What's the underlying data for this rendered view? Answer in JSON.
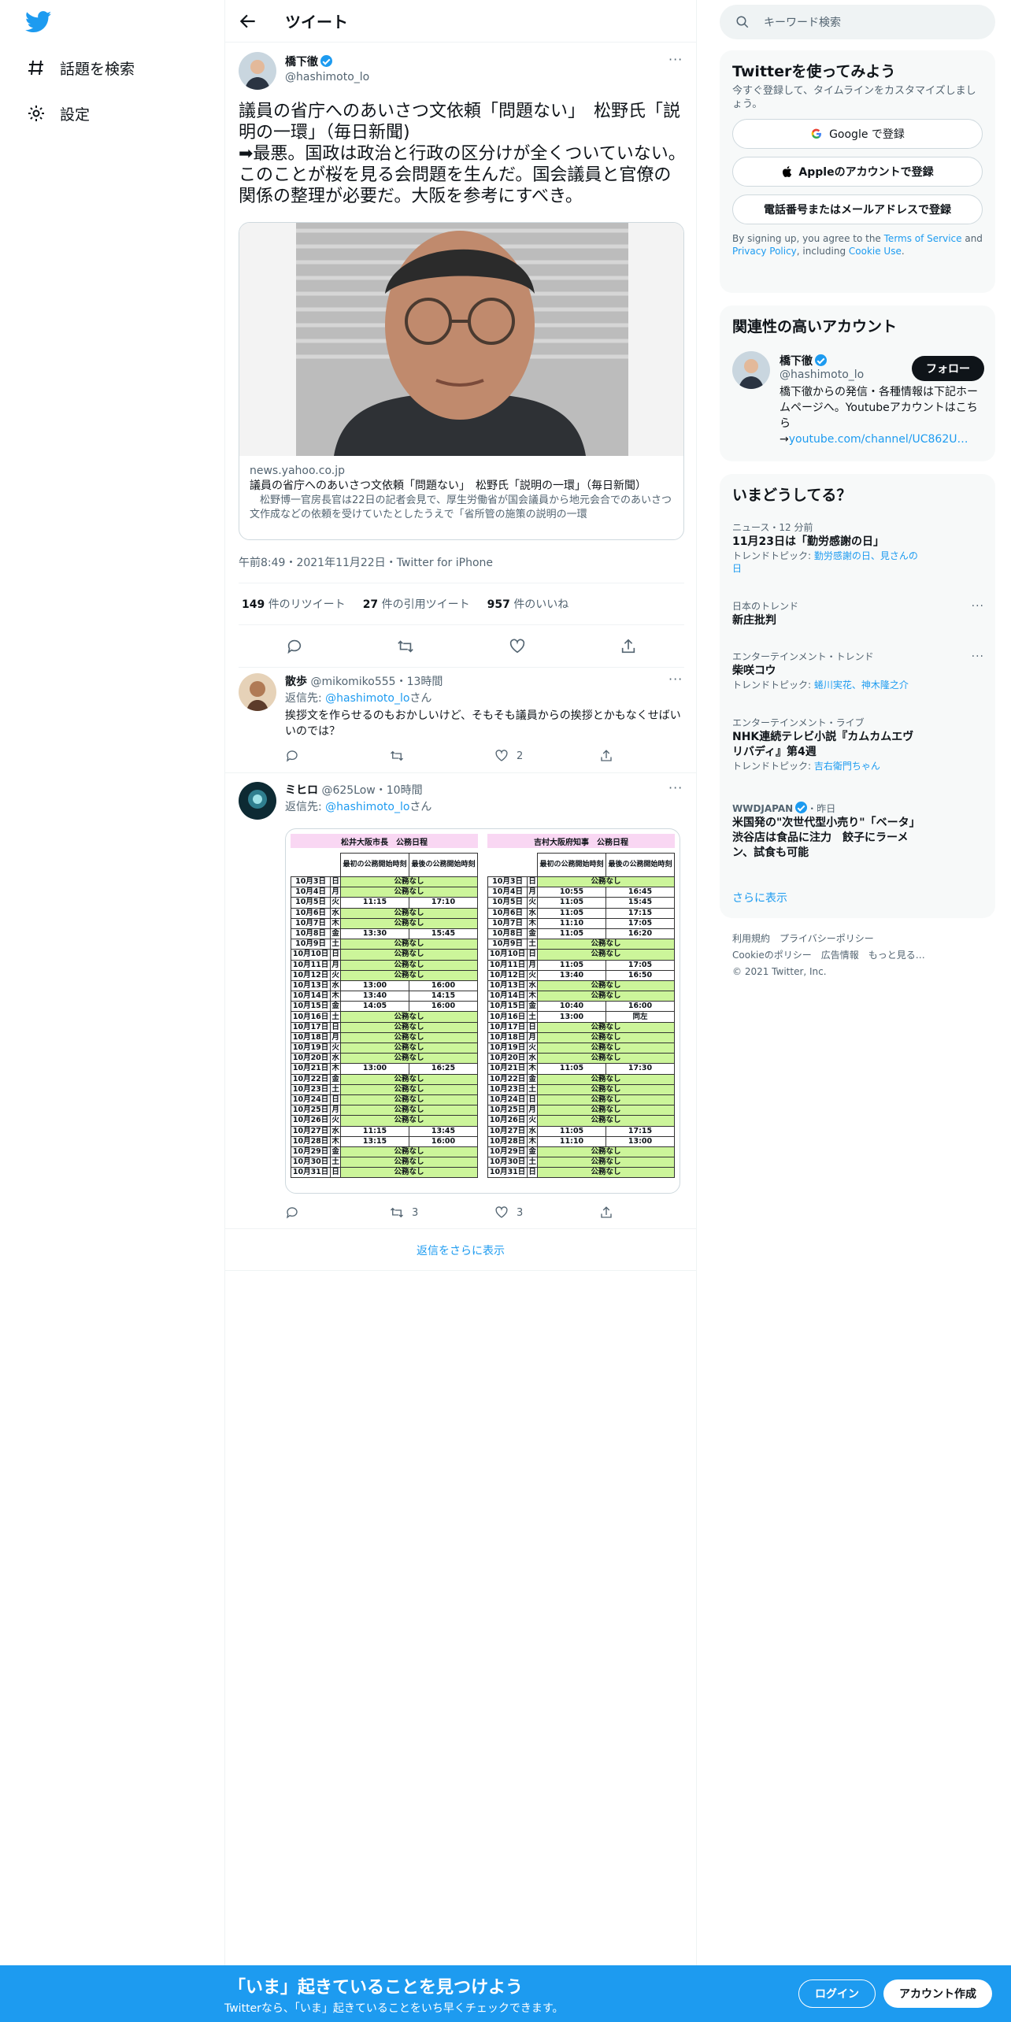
{
  "nav": {
    "explore": "話題を検索",
    "settings": "設定"
  },
  "header": {
    "title": "ツイート"
  },
  "tweet": {
    "author": "橋下徹",
    "handle": "@hashimoto_lo",
    "text": "議員の省庁へのあいさつ文依頼「問題ない」　松野氏「説明の一環」（毎日新聞)\n➡最悪。国政は政治と行政の区分けが全くついていない。このことが桜を見る会問題を生んだ。国会議員と官僚の関係の整理が必要だ。大阪を参考にすべき。",
    "card": {
      "domain": "news.yahoo.co.jp",
      "title": "議員の省庁へのあいさつ文依頼「問題ない」　松野氏「説明の一環」（毎日新聞）",
      "desc": "　松野博一官房長官は22日の記者会見で、厚生労働省が国会議員から地元会合でのあいさつ文作成などの依頼を受けていたとしたうえで「省所管の施策の説明の一環"
    },
    "time": "午前8:49・2021年11月22日・Twitter for iPhone",
    "retweets": "149",
    "retweets_label": "件のリツイート",
    "quotes": "27",
    "quotes_label": "件の引用ツイート",
    "likes": "957",
    "likes_label": "件のいいね"
  },
  "replies": [
    {
      "name": "散歩",
      "handle": "@mikomiko555",
      "time": "・13時間",
      "replying": "返信先: ",
      "to": "@hashimoto_lo",
      "san": "さん",
      "text": "挨拶文を作らせるのもおかしいけど、そもそも議員からの挨拶とかもなくせばいいのでは？",
      "reply_count": "",
      "rt_count": "",
      "like_count": "2"
    },
    {
      "name": "ミヒロ",
      "handle": "@625Low",
      "time": "・10時間",
      "replying": "返信先: ",
      "to": "@hashimoto_lo",
      "san": "さん",
      "text": "",
      "reply_count": "",
      "rt_count": "3",
      "like_count": "3"
    }
  ],
  "schedule": {
    "left_title": "松井大阪市長　公務日程",
    "right_title": "吉村大阪府知事　公務日程",
    "col_start": "最初の公務開始時刻",
    "col_end": "最後の公務開始時刻",
    "none": "公務なし",
    "left_rows": [
      [
        "10月3日",
        "日",
        "",
        ""
      ],
      [
        "10月4日",
        "月",
        "",
        ""
      ],
      [
        "10月5日",
        "火",
        "11:15",
        "17:10"
      ],
      [
        "10月6日",
        "水",
        "",
        ""
      ],
      [
        "10月7日",
        "木",
        "",
        ""
      ],
      [
        "10月8日",
        "金",
        "13:30",
        "15:45"
      ],
      [
        "10月9日",
        "土",
        "",
        ""
      ],
      [
        "10月10日",
        "日",
        "",
        ""
      ],
      [
        "10月11日",
        "月",
        "",
        ""
      ],
      [
        "10月12日",
        "火",
        "",
        ""
      ],
      [
        "10月13日",
        "水",
        "13:00",
        "16:00"
      ],
      [
        "10月14日",
        "木",
        "13:40",
        "14:15"
      ],
      [
        "10月15日",
        "金",
        "14:05",
        "16:00"
      ],
      [
        "10月16日",
        "土",
        "",
        ""
      ],
      [
        "10月17日",
        "日",
        "",
        ""
      ],
      [
        "10月18日",
        "月",
        "",
        ""
      ],
      [
        "10月19日",
        "火",
        "",
        ""
      ],
      [
        "10月20日",
        "水",
        "",
        ""
      ],
      [
        "10月21日",
        "木",
        "13:00",
        "16:25"
      ],
      [
        "10月22日",
        "金",
        "",
        ""
      ],
      [
        "10月23日",
        "土",
        "",
        ""
      ],
      [
        "10月24日",
        "日",
        "",
        ""
      ],
      [
        "10月25日",
        "月",
        "",
        ""
      ],
      [
        "10月26日",
        "火",
        "",
        ""
      ],
      [
        "10月27日",
        "水",
        "11:15",
        "13:45"
      ],
      [
        "10月28日",
        "木",
        "13:15",
        "16:00"
      ],
      [
        "10月29日",
        "金",
        "",
        ""
      ],
      [
        "10月30日",
        "土",
        "",
        ""
      ],
      [
        "10月31日",
        "日",
        "",
        ""
      ]
    ],
    "right_rows": [
      [
        "10月3日",
        "日",
        "",
        ""
      ],
      [
        "10月4日",
        "月",
        "10:55",
        "16:45"
      ],
      [
        "10月5日",
        "火",
        "11:05",
        "15:45"
      ],
      [
        "10月6日",
        "水",
        "11:05",
        "17:15"
      ],
      [
        "10月7日",
        "木",
        "11:10",
        "17:05"
      ],
      [
        "10月8日",
        "金",
        "11:05",
        "16:20"
      ],
      [
        "10月9日",
        "土",
        "",
        ""
      ],
      [
        "10月10日",
        "日",
        "",
        ""
      ],
      [
        "10月11日",
        "月",
        "11:05",
        "17:05"
      ],
      [
        "10月12日",
        "火",
        "13:40",
        "16:50"
      ],
      [
        "10月13日",
        "水",
        "",
        ""
      ],
      [
        "10月14日",
        "木",
        "",
        ""
      ],
      [
        "10月15日",
        "金",
        "10:40",
        "16:00"
      ],
      [
        "10月16日",
        "土",
        "13:00",
        "同左"
      ],
      [
        "10月17日",
        "日",
        "",
        ""
      ],
      [
        "10月18日",
        "月",
        "",
        ""
      ],
      [
        "10月19日",
        "火",
        "",
        ""
      ],
      [
        "10月20日",
        "水",
        "",
        ""
      ],
      [
        "10月21日",
        "木",
        "11:05",
        "17:30"
      ],
      [
        "10月22日",
        "金",
        "",
        ""
      ],
      [
        "10月23日",
        "土",
        "",
        ""
      ],
      [
        "10月24日",
        "日",
        "",
        ""
      ],
      [
        "10月25日",
        "月",
        "",
        ""
      ],
      [
        "10月26日",
        "火",
        "",
        ""
      ],
      [
        "10月27日",
        "水",
        "11:05",
        "17:15"
      ],
      [
        "10月28日",
        "木",
        "11:10",
        "13:00"
      ],
      [
        "10月29日",
        "金",
        "",
        ""
      ],
      [
        "10月30日",
        "土",
        "",
        ""
      ],
      [
        "10月31日",
        "日",
        "",
        ""
      ]
    ]
  },
  "show_more_replies": "返信をさらに表示",
  "sidebar": {
    "search_placeholder": "キーワード検索",
    "signup_title": "Twitterを使ってみよう",
    "signup_sub": "今すぐ登録して、タイムラインをカスタマイズしましょう。",
    "google": "Google で登録",
    "apple": "Appleのアカウントで登録",
    "phone": "電話番号またはメールアドレスで登録",
    "terms_1": "By signing up, you agree to the ",
    "terms_link1": "Terms of Service",
    "terms_2": " and ",
    "terms_link2": "Privacy Policy",
    "terms_3": ", including ",
    "terms_link3": "Cookie Use",
    "terms_4": ".",
    "related_title": "関連性の高いアカウント",
    "related_name": "橋下徹",
    "related_handle": "@hashimoto_lo",
    "follow": "フォロー",
    "related_bio": "橋下徹からの発信・各種情報は下記ホームページへ。Youtubeアカウントはこちら\n→",
    "related_link": "youtube.com/channel/UC862U…",
    "trends_title": "いまどうしてる？",
    "trends": [
      {
        "meta": "ニュース・12 分前",
        "title": "11月23日は「勤労感謝の日」",
        "topic_label": "トレンドトピック: ",
        "topic": "勤労感謝の日、見さんの日"
      },
      {
        "meta": "日本のトレンド",
        "title": "新庄批判",
        "topic_label": "",
        "topic": ""
      },
      {
        "meta": "エンターテインメント・トレンド",
        "title": "柴咲コウ",
        "topic_label": "トレンドトピック: ",
        "topic": "蜷川実花、神木隆之介"
      },
      {
        "meta": "エンターテインメント・ライブ",
        "title": "NHK連続テレビ小説『カムカムエヴリバディ』第4週",
        "topic_label": "トレンドトピック: ",
        "topic": "吉右衛門ちゃん"
      },
      {
        "meta": "WWDJAPAN",
        "meta2": "・昨日",
        "title": "米国発の\"次世代型小売り\"「ベータ」渋谷店は食品に注力　餃子にラーメン、試食も可能",
        "topic_label": "",
        "topic": ""
      }
    ],
    "show_more": "さらに表示",
    "footer1": "利用規約　プライバシーポリシー",
    "footer2": "Cookieのポリシー　広告情報　もっと見る…",
    "footer3": "© 2021 Twitter, Inc."
  },
  "bottom": {
    "title": "「いま」起きていることを見つけよう",
    "sub": "Twitterなら、「いま」起きていることをいち早くチェックできます。",
    "login": "ログイン",
    "signup": "アカウント作成"
  },
  "colors": {
    "accent": "#1d9bf0",
    "text": "#0f1419",
    "muted": "#536471",
    "schedule_green": "#ccf59a",
    "schedule_pink": "#f9d7f3"
  }
}
